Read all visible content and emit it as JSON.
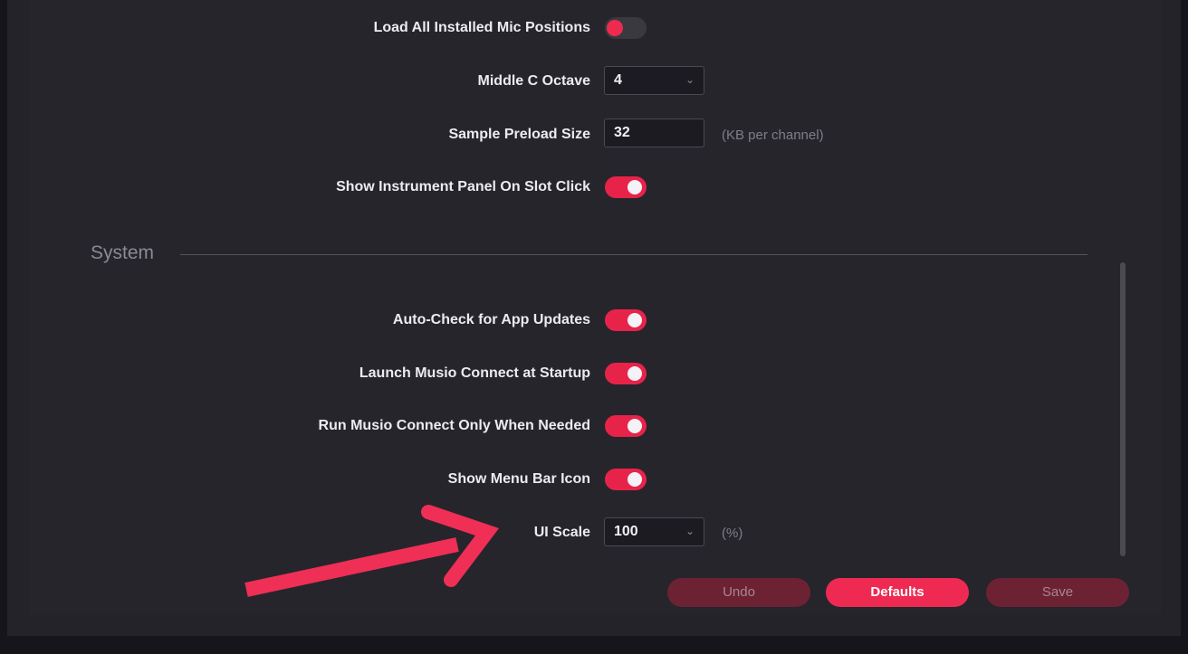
{
  "settings": {
    "load_mic_positions": {
      "label": "Load All Installed Mic Positions",
      "state": "off"
    },
    "middle_c_octave": {
      "label": "Middle C Octave",
      "value": "4"
    },
    "sample_preload": {
      "label": "Sample Preload Size",
      "value": "32",
      "unit": "(KB per channel)"
    },
    "show_instrument_panel": {
      "label": "Show Instrument Panel On Slot Click",
      "state": "on"
    }
  },
  "system": {
    "title": "System",
    "auto_check": {
      "label": "Auto-Check for App Updates",
      "state": "on"
    },
    "launch_connect": {
      "label": "Launch Musio Connect at Startup",
      "state": "on"
    },
    "run_connect": {
      "label": "Run Musio Connect Only When Needed",
      "state": "on"
    },
    "menu_bar_icon": {
      "label": "Show Menu Bar Icon",
      "state": "on"
    },
    "ui_scale": {
      "label": "UI Scale",
      "value": "100",
      "unit": "(%)"
    }
  },
  "footer": {
    "undo_label": "Undo",
    "defaults_label": "Defaults",
    "save_label": "Save"
  },
  "icons": {
    "dropdown": "chevron-down-icon",
    "annotation": "arrow-icon"
  },
  "colors": {
    "accent": "#e8234a",
    "annotation_arrow": "#ef2f55",
    "background": "#26252c"
  }
}
